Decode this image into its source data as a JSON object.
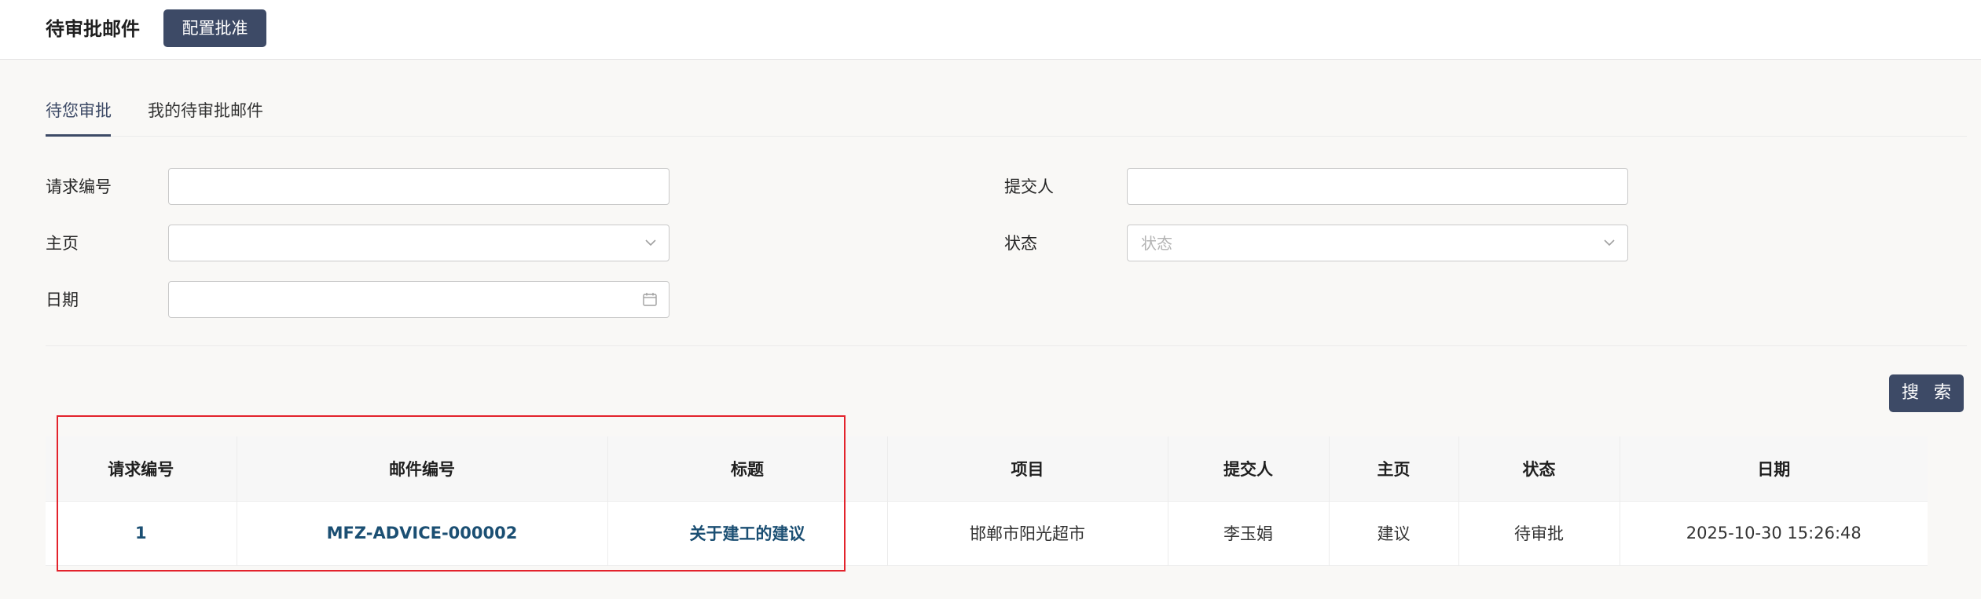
{
  "header": {
    "title": "待审批邮件",
    "config_button": "配置批准"
  },
  "tabs": [
    {
      "label": "待您审批",
      "active": true
    },
    {
      "label": "我的待审批邮件",
      "active": false
    }
  ],
  "filters": {
    "request_no": {
      "label": "请求编号",
      "value": ""
    },
    "submitter": {
      "label": "提交人",
      "value": ""
    },
    "home": {
      "label": "主页",
      "value": ""
    },
    "status": {
      "label": "状态",
      "placeholder": "状态"
    },
    "date": {
      "label": "日期",
      "value": ""
    }
  },
  "search_button": "搜 索",
  "table": {
    "columns": [
      "请求编号",
      "邮件编号",
      "标题",
      "项目",
      "提交人",
      "主页",
      "状态",
      "日期"
    ],
    "rows": [
      [
        "1",
        "MFZ-ADVICE-000002",
        "关于建工的建议",
        "邯郸市阳光超市",
        "李玉娟",
        "建议",
        "待审批",
        "2025-10-30 15:26:48"
      ]
    ]
  },
  "colors": {
    "primary": "#3d4a66",
    "link": "#1b4f73",
    "highlight": "#e3232c",
    "background": "#f9f8f6"
  },
  "icons": [
    "chevron-down-icon",
    "calendar-icon"
  ]
}
